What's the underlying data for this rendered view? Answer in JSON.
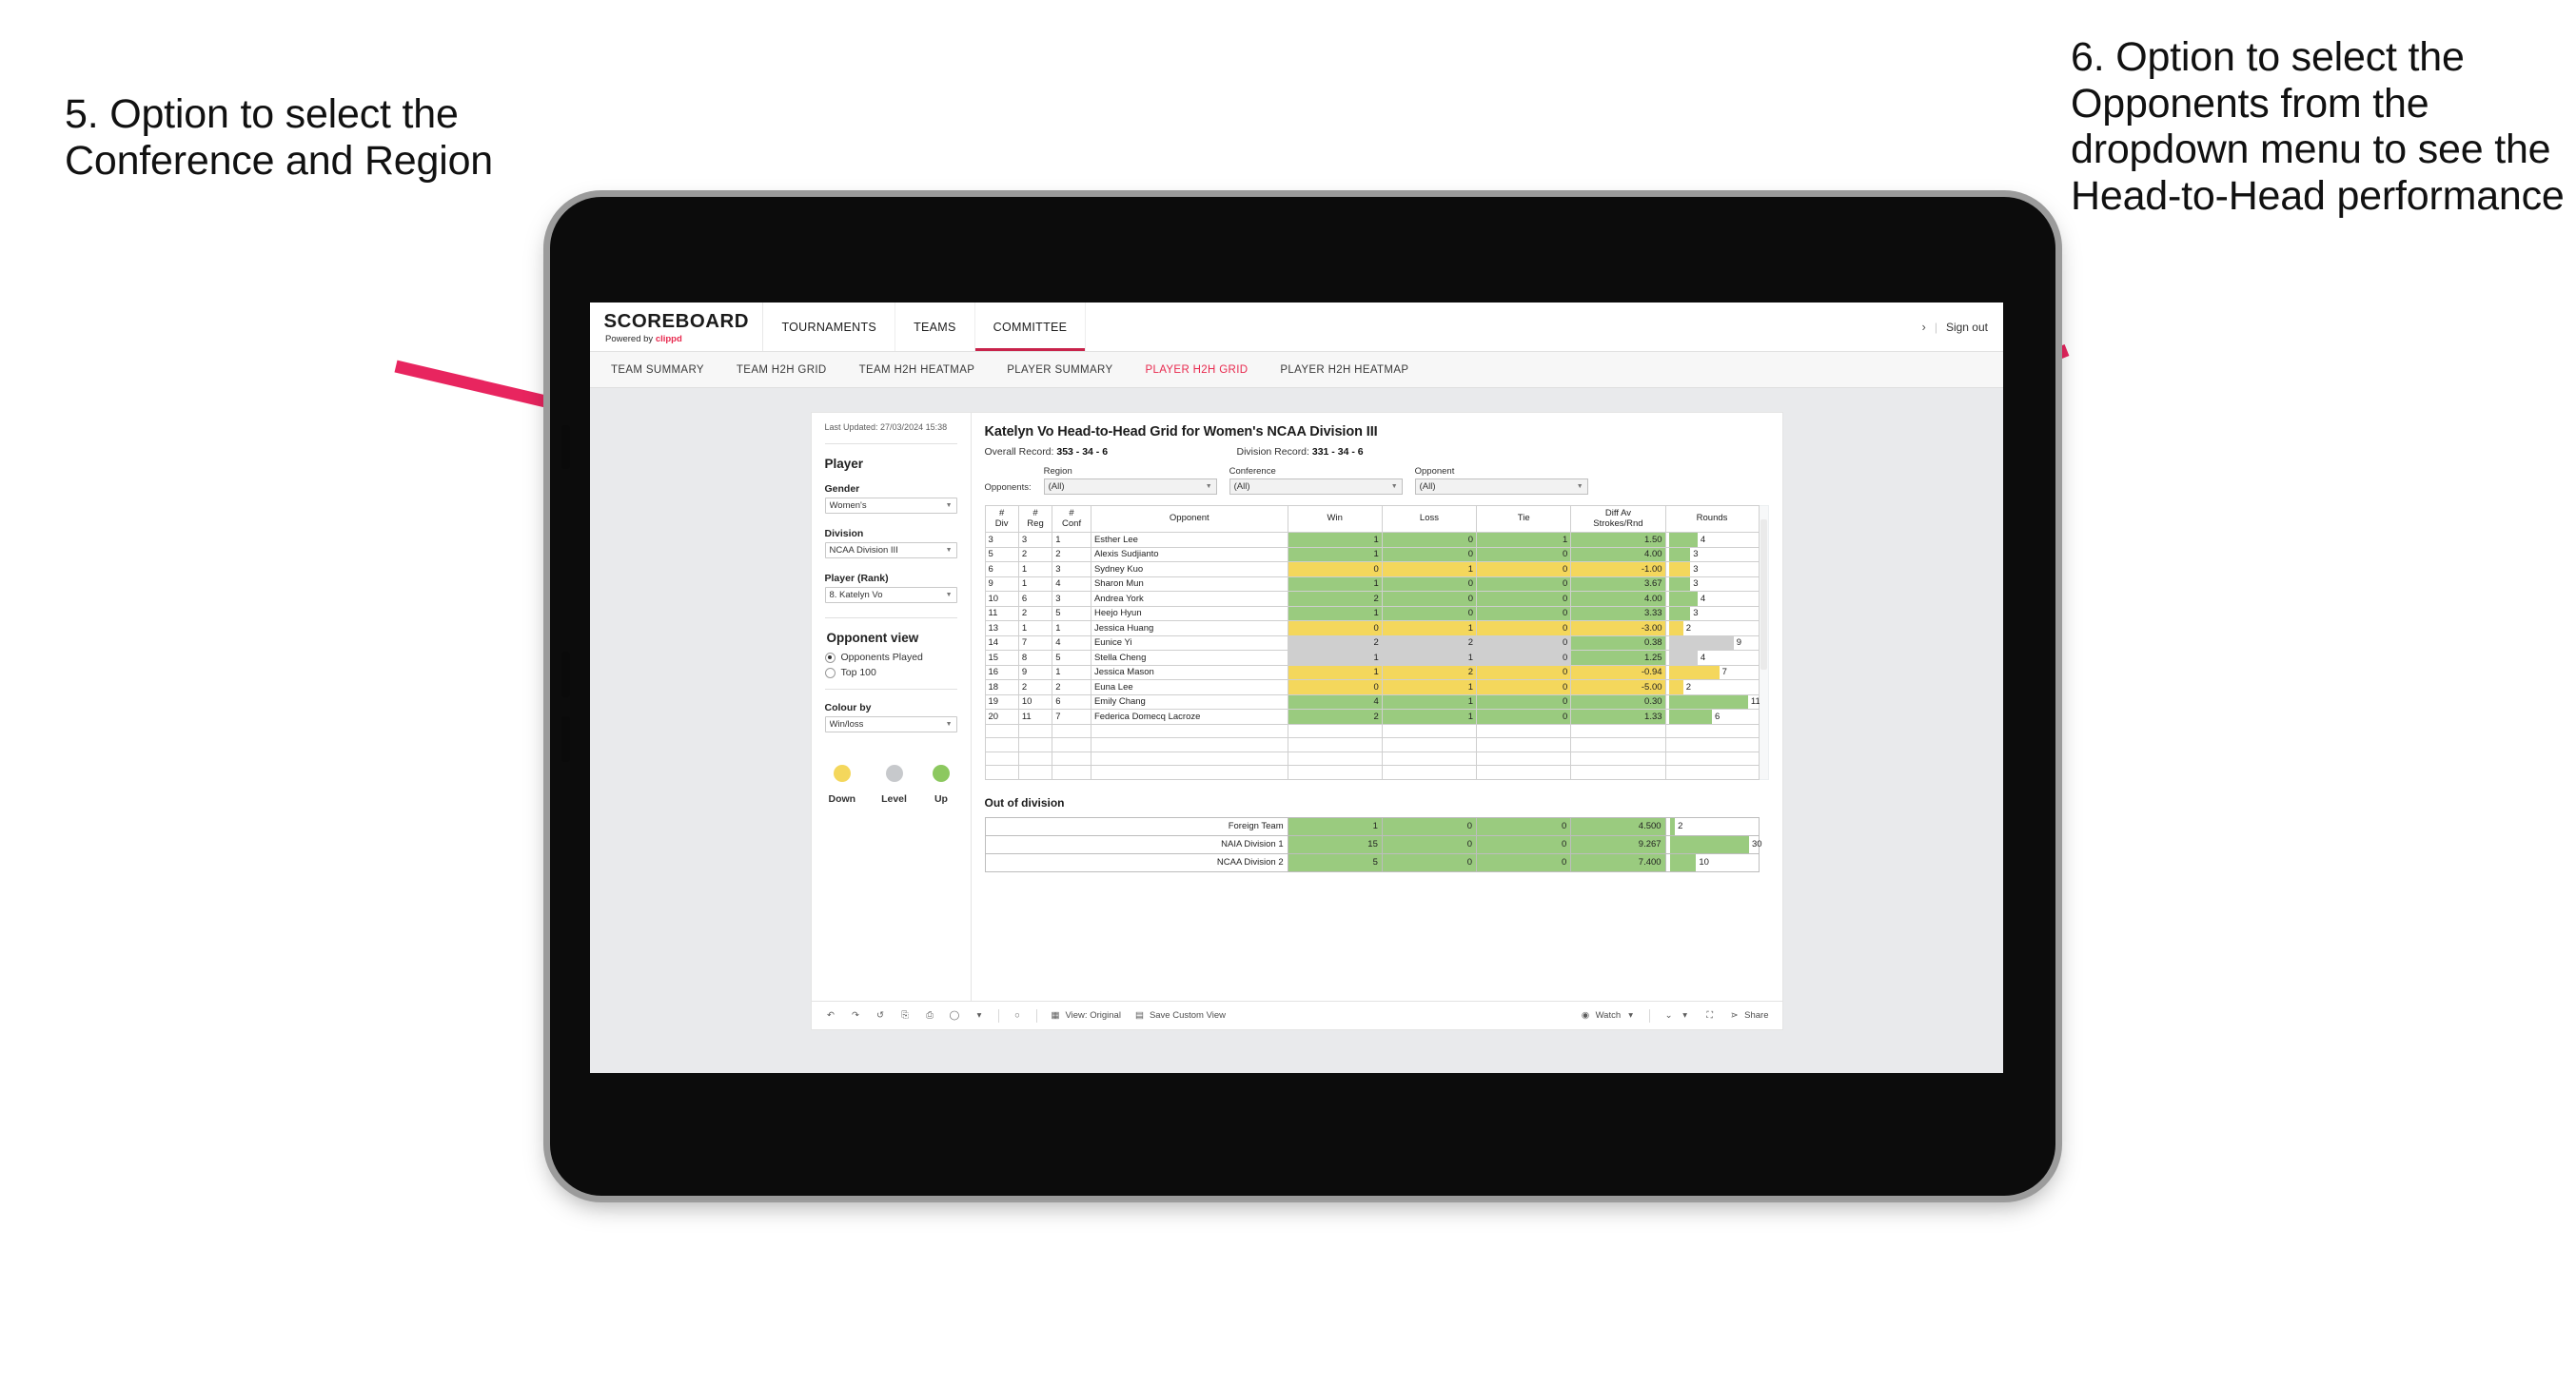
{
  "annotations": {
    "left": "5. Option to select the Conference and Region",
    "right": "6. Option to select the Opponents from the dropdown menu to see the Head-to-Head performance",
    "arrow_color": "#e8255f"
  },
  "app": {
    "brand_name": "SCOREBOARD",
    "brand_powered_prefix": "Powered by ",
    "brand_powered_name": "clippd",
    "top_nav": [
      {
        "label": "TOURNAMENTS",
        "active": false
      },
      {
        "label": "TEAMS",
        "active": false
      },
      {
        "label": "COMMITTEE",
        "active": true
      }
    ],
    "top_right": {
      "chevron": "›",
      "divider": "|",
      "sign_out": "Sign out"
    },
    "sub_nav": [
      {
        "label": "TEAM SUMMARY",
        "active": false
      },
      {
        "label": "TEAM H2H GRID",
        "active": false
      },
      {
        "label": "TEAM H2H HEATMAP",
        "active": false
      },
      {
        "label": "PLAYER SUMMARY",
        "active": false
      },
      {
        "label": "PLAYER H2H GRID",
        "active": true
      },
      {
        "label": "PLAYER H2H HEATMAP",
        "active": false
      }
    ]
  },
  "panel": {
    "last_updated": "Last Updated: 27/03/2024 15:38",
    "player_heading": "Player",
    "gender": {
      "label": "Gender",
      "value": "Women's"
    },
    "division": {
      "label": "Division",
      "value": "NCAA Division III"
    },
    "player_rank": {
      "label": "Player (Rank)",
      "value": "8. Katelyn Vo"
    },
    "opponent_view": {
      "heading": "Opponent view",
      "options": [
        {
          "label": "Opponents Played",
          "selected": true
        },
        {
          "label": "Top 100",
          "selected": false
        }
      ]
    },
    "colour_by": {
      "label": "Colour by",
      "value": "Win/loss"
    },
    "legend": [
      {
        "label": "Down",
        "color": "#f4d75c"
      },
      {
        "label": "Level",
        "color": "#c7c9cc"
      },
      {
        "label": "Up",
        "color": "#8cc85f"
      }
    ]
  },
  "viz": {
    "title": "Katelyn Vo Head-to-Head Grid for Women's NCAA Division III",
    "overall_record_label": "Overall Record: ",
    "overall_record_value": "353 - 34 - 6",
    "division_record_label": "Division Record: ",
    "division_record_value": "331 - 34 - 6",
    "opponents_label": "Opponents:",
    "filters": [
      {
        "label": "Region",
        "value": "(All)"
      },
      {
        "label": "Conference",
        "value": "(All)"
      },
      {
        "label": "Opponent",
        "value": "(All)"
      }
    ]
  },
  "chart_data": {
    "type": "table",
    "title": "Katelyn Vo Head-to-Head Grid for Women's NCAA Division III",
    "columns": [
      "# Div",
      "# Reg",
      "# Conf",
      "Opponent",
      "Win",
      "Loss",
      "Tie",
      "Diff Av Strokes/Rnd",
      "Rounds"
    ],
    "column_headers_two_line": [
      {
        "l1": "#",
        "l2": "Div"
      },
      {
        "l1": "#",
        "l2": "Reg"
      },
      {
        "l1": "#",
        "l2": "Conf"
      },
      {
        "l1": "Opponent",
        "l2": ""
      },
      {
        "l1": "Win",
        "l2": ""
      },
      {
        "l1": "Loss",
        "l2": ""
      },
      {
        "l1": "Tie",
        "l2": ""
      },
      {
        "l1": "Diff Av",
        "l2": "Strokes/Rnd"
      },
      {
        "l1": "Rounds",
        "l2": ""
      }
    ],
    "rounds_max": 12,
    "rows": [
      {
        "div": "3",
        "reg": "3",
        "conf": "1",
        "opponent": "Esther Lee",
        "win": "1",
        "loss": "0",
        "tie": "1",
        "diff": "1.50",
        "rounds": "4",
        "color": "green"
      },
      {
        "div": "5",
        "reg": "2",
        "conf": "2",
        "opponent": "Alexis Sudjianto",
        "win": "1",
        "loss": "0",
        "tie": "0",
        "diff": "4.00",
        "rounds": "3",
        "color": "green"
      },
      {
        "div": "6",
        "reg": "1",
        "conf": "3",
        "opponent": "Sydney Kuo",
        "win": "0",
        "loss": "1",
        "tie": "0",
        "diff": "-1.00",
        "rounds": "3",
        "color": "yellow"
      },
      {
        "div": "9",
        "reg": "1",
        "conf": "4",
        "opponent": "Sharon Mun",
        "win": "1",
        "loss": "0",
        "tie": "0",
        "diff": "3.67",
        "rounds": "3",
        "color": "green"
      },
      {
        "div": "10",
        "reg": "6",
        "conf": "3",
        "opponent": "Andrea York",
        "win": "2",
        "loss": "0",
        "tie": "0",
        "diff": "4.00",
        "rounds": "4",
        "color": "green"
      },
      {
        "div": "11",
        "reg": "2",
        "conf": "5",
        "opponent": "Heejo Hyun",
        "win": "1",
        "loss": "0",
        "tie": "0",
        "diff": "3.33",
        "rounds": "3",
        "color": "green"
      },
      {
        "div": "13",
        "reg": "1",
        "conf": "1",
        "opponent": "Jessica Huang",
        "win": "0",
        "loss": "1",
        "tie": "0",
        "diff": "-3.00",
        "rounds": "2",
        "color": "yellow"
      },
      {
        "div": "14",
        "reg": "7",
        "conf": "4",
        "opponent": "Eunice Yi",
        "win": "2",
        "loss": "2",
        "tie": "0",
        "diff": "0.38",
        "rounds": "9",
        "color": "grey",
        "diff_color": "green"
      },
      {
        "div": "15",
        "reg": "8",
        "conf": "5",
        "opponent": "Stella Cheng",
        "win": "1",
        "loss": "1",
        "tie": "0",
        "diff": "1.25",
        "rounds": "4",
        "color": "grey",
        "diff_color": "green"
      },
      {
        "div": "16",
        "reg": "9",
        "conf": "1",
        "opponent": "Jessica Mason",
        "win": "1",
        "loss": "2",
        "tie": "0",
        "diff": "-0.94",
        "rounds": "7",
        "color": "yellow"
      },
      {
        "div": "18",
        "reg": "2",
        "conf": "2",
        "opponent": "Euna Lee",
        "win": "0",
        "loss": "1",
        "tie": "0",
        "diff": "-5.00",
        "rounds": "2",
        "color": "yellow"
      },
      {
        "div": "19",
        "reg": "10",
        "conf": "6",
        "opponent": "Emily Chang",
        "win": "4",
        "loss": "1",
        "tie": "0",
        "diff": "0.30",
        "rounds": "11",
        "color": "green"
      },
      {
        "div": "20",
        "reg": "11",
        "conf": "7",
        "opponent": "Federica Domecq Lacroze",
        "win": "2",
        "loss": "1",
        "tie": "0",
        "diff": "1.33",
        "rounds": "6",
        "color": "green"
      }
    ]
  },
  "out_of_division": {
    "title": "Out of division",
    "rounds_max": 32,
    "rows": [
      {
        "name": "Foreign Team",
        "win": "1",
        "loss": "0",
        "tie": "0",
        "diff": "4.500",
        "rounds": "2",
        "color": "green"
      },
      {
        "name": "NAIA Division 1",
        "win": "15",
        "loss": "0",
        "tie": "0",
        "diff": "9.267",
        "rounds": "30",
        "color": "green"
      },
      {
        "name": "NCAA Division 2",
        "win": "5",
        "loss": "0",
        "tie": "0",
        "diff": "7.400",
        "rounds": "10",
        "color": "green"
      }
    ]
  },
  "toolbar": {
    "view_original": "View: Original",
    "save_custom_view": "Save Custom View",
    "watch": "Watch",
    "share": "Share",
    "caret": "▾"
  }
}
